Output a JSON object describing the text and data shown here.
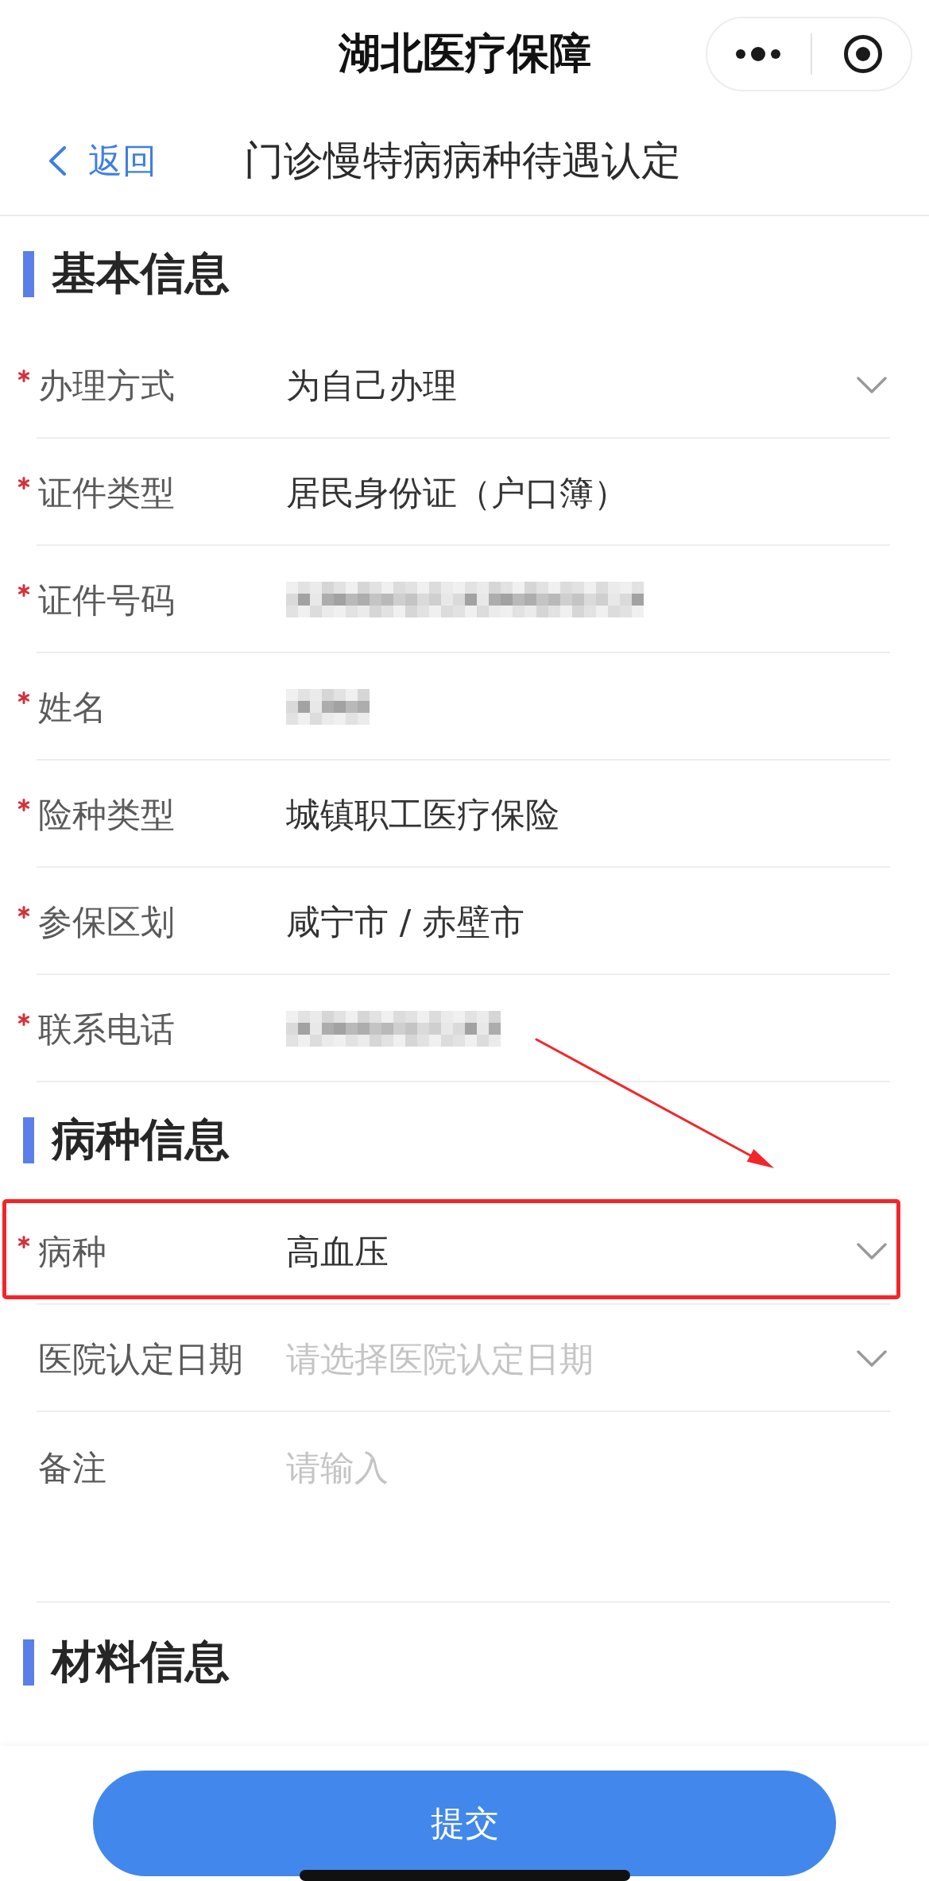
{
  "nav_bar": {
    "title": "湖北医疗保障"
  },
  "header": {
    "back_label": "返回",
    "title": "门诊慢特病病种待遇认定"
  },
  "sections": [
    {
      "title": "基本信息",
      "rows": [
        {
          "kind": "select",
          "label": "办理方式",
          "required": true,
          "highlighted": false,
          "value": "为自己办理"
        },
        {
          "kind": "text",
          "label": "证件类型",
          "required": true,
          "highlighted": false,
          "value": "居民身份证（户口簿）"
        },
        {
          "kind": "longmask",
          "label": "证件号码",
          "required": true,
          "highlighted": false
        },
        {
          "kind": "shortmask",
          "label": "姓名",
          "required": true,
          "highlighted": false
        },
        {
          "kind": "text",
          "label": "险种类型",
          "required": true,
          "highlighted": false,
          "value": "城镇职工医疗保险"
        },
        {
          "kind": "text",
          "label": "参保区划",
          "required": true,
          "highlighted": false,
          "value": "咸宁市 / 赤壁市"
        },
        {
          "kind": "midmask",
          "label": "联系电话",
          "required": true,
          "highlighted": false
        }
      ]
    },
    {
      "title": "病种信息",
      "rows": [
        {
          "kind": "select",
          "label": "病种",
          "required": true,
          "highlighted": true,
          "value": "高血压"
        },
        {
          "kind": "select",
          "label": "医院认定日期",
          "required": false,
          "highlighted": false,
          "placeholder": "请选择医院认定日期"
        },
        {
          "kind": "textarea",
          "label": "备注",
          "required": false,
          "highlighted": false,
          "placeholder": "请输入"
        }
      ]
    },
    {
      "title": "材料信息"
    }
  ],
  "submit_button": {
    "label": "提交"
  }
}
